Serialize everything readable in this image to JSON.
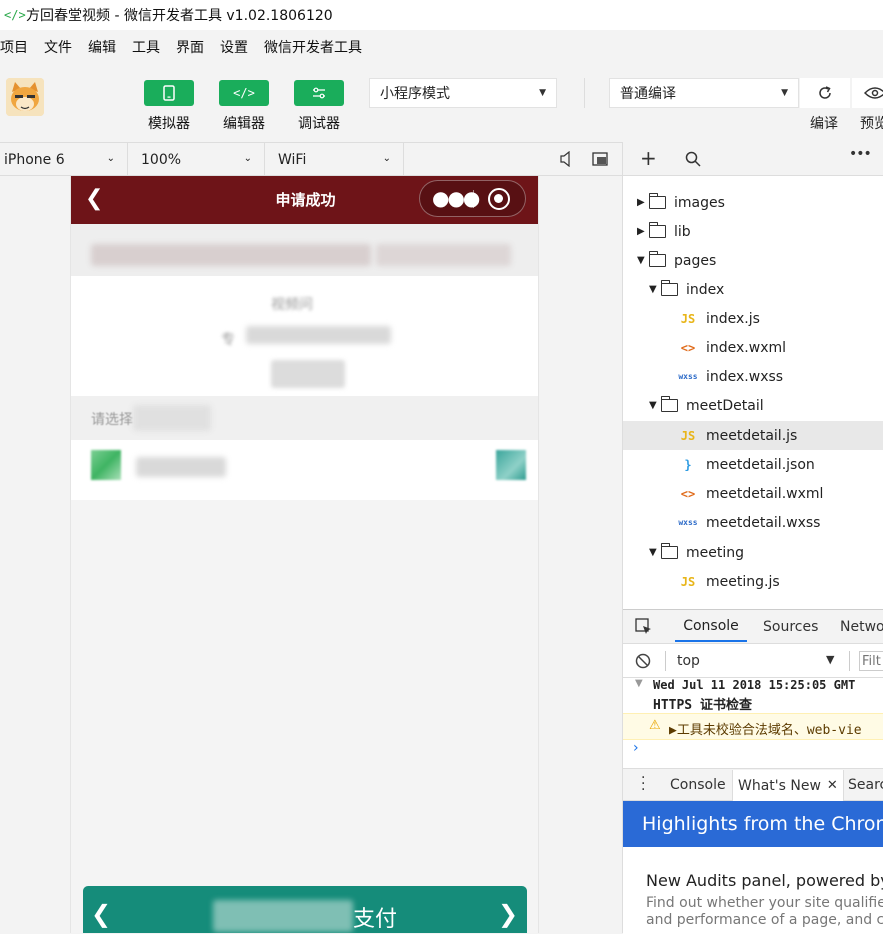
{
  "window": {
    "title": "方回春堂视频 - 微信开发者工具 v1.02.1806120"
  },
  "menu": [
    "项目",
    "文件",
    "编辑",
    "工具",
    "界面",
    "设置",
    "微信开发者工具"
  ],
  "toolbar": {
    "simulator_label": "模拟器",
    "editor_label": "编辑器",
    "debugger_label": "调试器",
    "mode_select": "小程序模式",
    "compile_select": "普通编译",
    "compile_label": "编译",
    "preview_label": "预览"
  },
  "device": {
    "model": "iPhone 6",
    "zoom": "100%",
    "network": "WiFi"
  },
  "phone": {
    "nav_title": "申请成功",
    "fragments": [
      "视频问",
      "专",
      "请选择"
    ],
    "pay_button": "支付"
  },
  "file_tree": [
    {
      "name": "images",
      "type": "folder",
      "depth": 0,
      "open": false
    },
    {
      "name": "lib",
      "type": "folder",
      "depth": 0,
      "open": false
    },
    {
      "name": "pages",
      "type": "folder",
      "depth": 0,
      "open": true
    },
    {
      "name": "index",
      "type": "folder",
      "depth": 1,
      "open": true
    },
    {
      "name": "index.js",
      "type": "js",
      "depth": 2
    },
    {
      "name": "index.wxml",
      "type": "wxml",
      "depth": 2
    },
    {
      "name": "index.wxss",
      "type": "wxss",
      "depth": 2
    },
    {
      "name": "meetDetail",
      "type": "folder",
      "depth": 1,
      "open": true
    },
    {
      "name": "meetdetail.js",
      "type": "js",
      "depth": 2,
      "selected": true
    },
    {
      "name": "meetdetail.json",
      "type": "json",
      "depth": 2
    },
    {
      "name": "meetdetail.wxml",
      "type": "wxml",
      "depth": 2
    },
    {
      "name": "meetdetail.wxss",
      "type": "wxss",
      "depth": 2
    },
    {
      "name": "meeting",
      "type": "folder",
      "depth": 1,
      "open": true
    },
    {
      "name": "meeting.js",
      "type": "js",
      "depth": 2
    }
  ],
  "icons": {
    "js": "JS",
    "wxml": "<>",
    "wxss": "wxss",
    "json": "}"
  },
  "console": {
    "tabs": [
      "Console",
      "Sources",
      "Netwo"
    ],
    "context": "top",
    "filter_placeholder": "Filt",
    "log_line1": "Wed Jul 11 2018 15:25:05 GMT",
    "log_line2": "HTTPS 证书检查",
    "warning": "▶工具未校验合法域名、web-vie",
    "drawer_tabs": [
      "Console",
      "What's New",
      "Search"
    ],
    "highlights_title": "Highlights from the Chrome",
    "news_title": "New Audits panel, powered by",
    "news_line1": "Find out whether your site qualifie",
    "news_line2": "and performance of a page, and c"
  },
  "colors": {
    "nav": "#6e1418",
    "green_button": "#1aad5b",
    "pay": "#158c7a",
    "devtools_blue": "#2a6ad6",
    "tab_active": "#1a73e8"
  }
}
